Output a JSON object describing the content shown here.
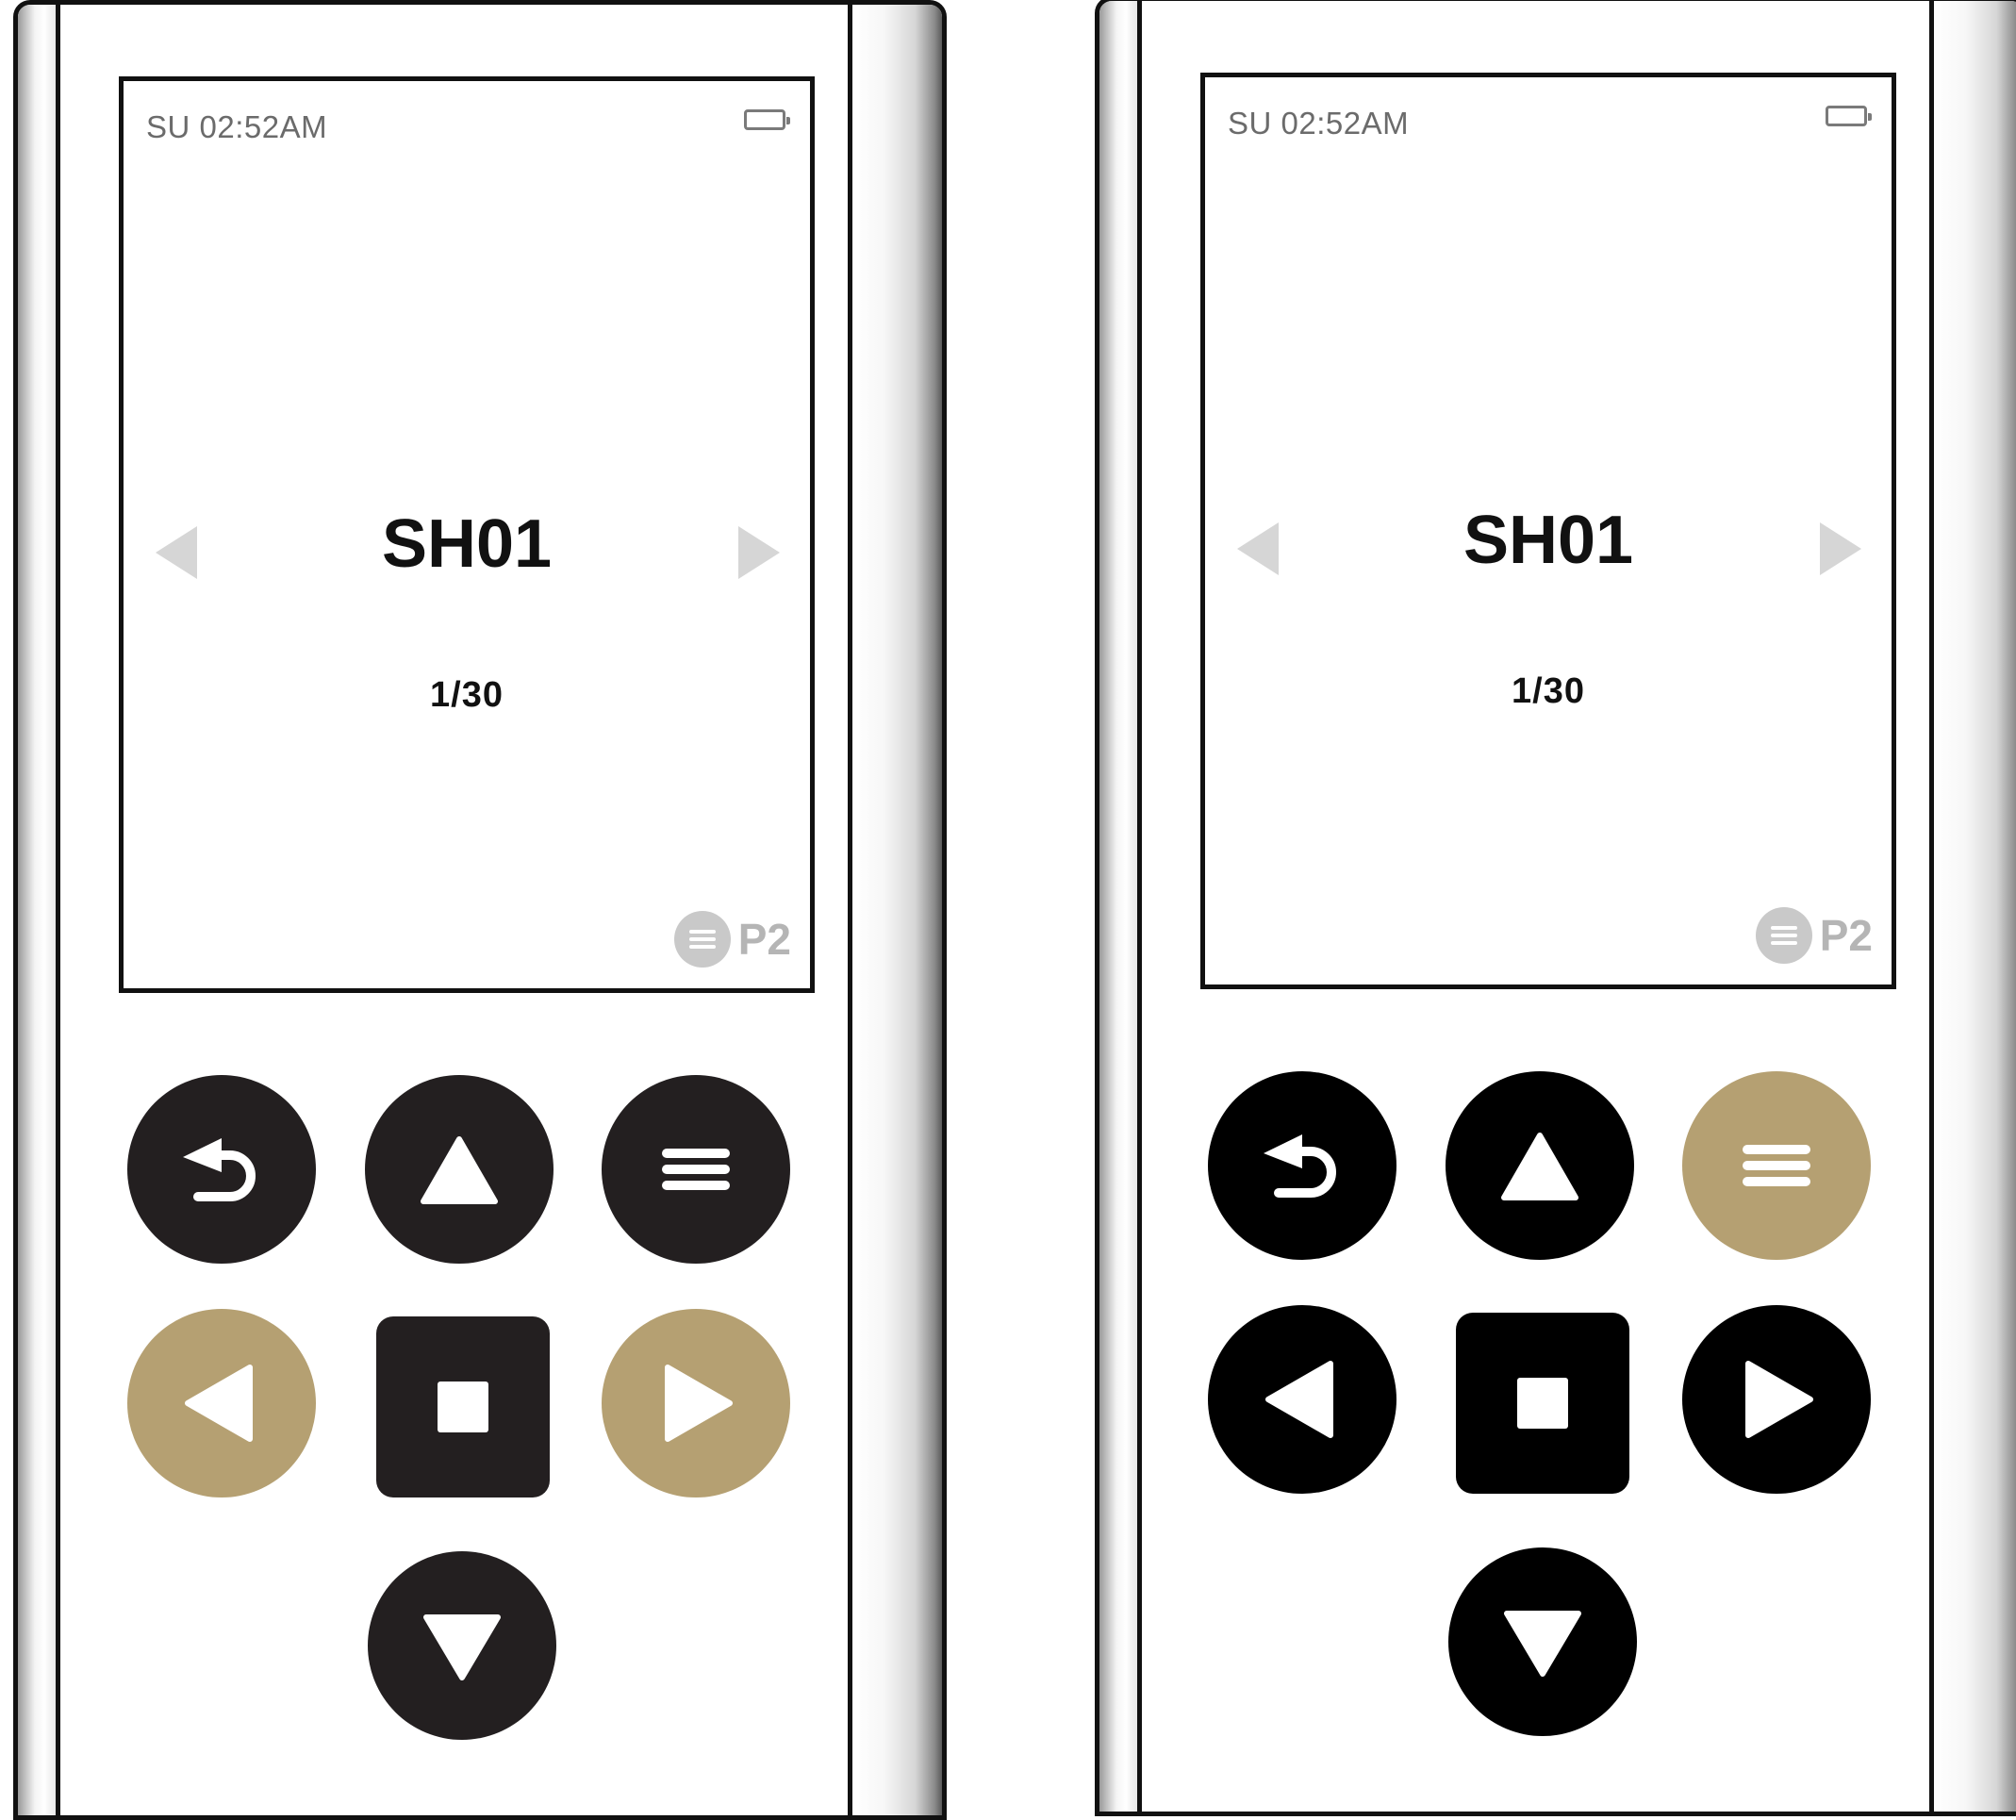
{
  "colors": {
    "key_dark_left": "#231f20",
    "key_dark_right": "#000000",
    "key_active": "#b5a072",
    "screen_muted": "#d6d6d6",
    "preset_muted": "#c9c9c9"
  },
  "remotes": [
    {
      "screen": {
        "clock": "SU 02:52AM",
        "scene_name": "SH01",
        "scene_count": "1/30",
        "preset_label": "P2",
        "battery_icon": "battery-icon"
      },
      "highlighted_keys": [
        "left",
        "right"
      ]
    },
    {
      "screen": {
        "clock": "SU 02:52AM",
        "scene_name": "SH01",
        "scene_count": "1/30",
        "preset_label": "P2",
        "battery_icon": "battery-icon"
      },
      "highlighted_keys": [
        "menu"
      ]
    }
  ],
  "keys": [
    "back",
    "up",
    "menu",
    "left",
    "stop",
    "right",
    "down"
  ]
}
